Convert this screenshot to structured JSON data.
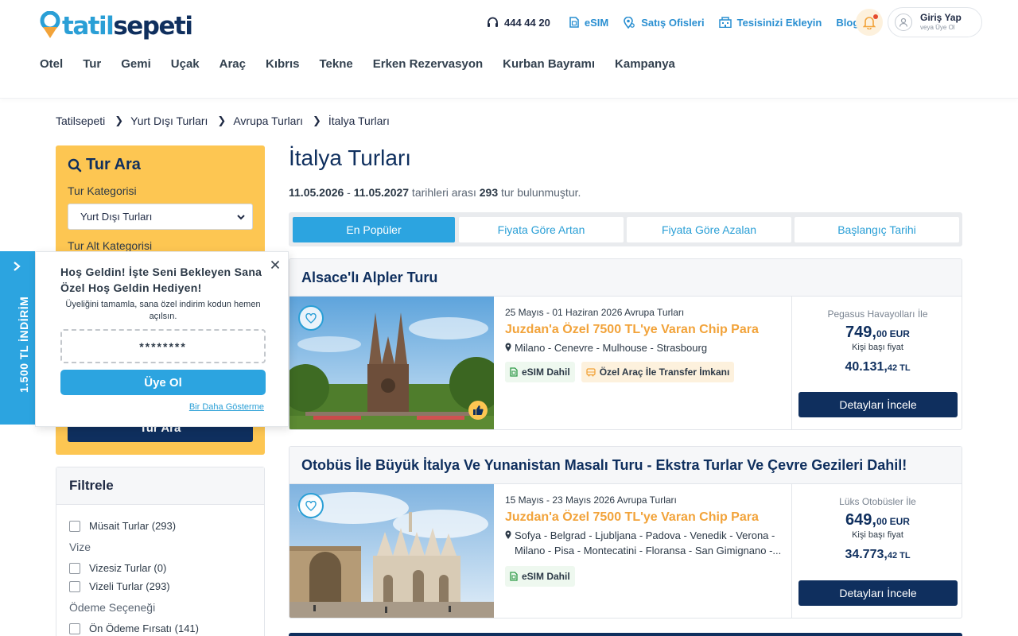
{
  "brand": {
    "part1": "tatil",
    "part2": "sepeti"
  },
  "colors": {
    "primary": "#2ca4e0",
    "navy": "#0f2f5e",
    "accent": "#fdc652",
    "promo": "#f2a33a"
  },
  "header": {
    "phone": "444 44 20",
    "links": [
      "eSIM",
      "Satış Ofisleri",
      "Tesisinizi Ekleyin",
      "Blog"
    ],
    "login_title": "Giriş Yap",
    "login_sub": "veya Üye Ol"
  },
  "nav": [
    "Otel",
    "Tur",
    "Gemi",
    "Uçak",
    "Araç",
    "Kıbrıs",
    "Tekne",
    "Erken Rezervasyon",
    "Kurban Bayramı",
    "Kampanya"
  ],
  "breadcrumb": [
    "Tatilsepeti",
    "Yurt Dışı Turları",
    "Avrupa Turları",
    "İtalya Turları"
  ],
  "search": {
    "title": "Tur Ara",
    "category_label": "Tur Kategorisi",
    "category_value": "Yurt Dışı Turları",
    "sub_label": "Tur Alt Kategorisi",
    "button": "Tur Ara"
  },
  "filters": {
    "title": "Filtrele",
    "musait": "Müsait Turlar (293)",
    "vize_label": "Vize",
    "vizesiz": "Vizesiz Turlar (0)",
    "vizeli": "Vizeli Turlar (293)",
    "odeme_label": "Ödeme Seçeneği",
    "on_odeme": "Ön Ödeme Fırsatı (141)"
  },
  "page": {
    "title": "İtalya Turları",
    "date_from": "11.05.2026",
    "dash": " - ",
    "date_to": "11.05.2027",
    "mid_text": " tarihleri arası ",
    "count": "293",
    "end_text": " tur bulunmuştur."
  },
  "sort_tabs": [
    "En Popüler",
    "Fiyata Göre Artan",
    "Fiyata Göre Azalan",
    "Başlangıç Tarihi"
  ],
  "tours": [
    {
      "title": "Alsace'lı Alpler Turu",
      "date": "25 Mayıs - 01 Haziran 2026 Avrupa Turları",
      "promo": "Juzdan'a Özel 7500 TL'ye Varan Chip Para",
      "route_line1": "Milano - Cenevre - Mulhouse - Strasbourg",
      "route_line2": "",
      "badge1": "eSIM Dahil",
      "badge2": "Özel Araç İle Transfer İmkanı",
      "carrier": "Pegasus Havayolları İle",
      "price_eur_int": "749,",
      "price_eur_dec": "00 EUR",
      "price_label": "Kişi başı fiyat",
      "price_tl_int": "40.131,",
      "price_tl_dec": "42 TL",
      "button": "Detayları İncele"
    },
    {
      "title": "Otobüs İle Büyük İtalya Ve Yunanistan Masalı Turu - Ekstra Turlar Ve Çevre Gezileri Dahil!",
      "date": "15 Mayıs - 23 Mayıs 2026 Avrupa Turları",
      "promo": "Juzdan'a Özel 7500 TL'ye Varan Chip Para",
      "route_line1": "Sofya - Belgrad - Ljubljana - Padova - Venedik - Verona -",
      "route_line2": "Milano - Pisa - Montecatini - Floransa - San Gimignano -...",
      "badge1": "eSIM Dahil",
      "carrier": "Lüks Otobüsler İle",
      "price_eur_int": "649,",
      "price_eur_dec": "00 EUR",
      "price_label": "Kişi başı fiyat",
      "price_tl_int": "34.773,",
      "price_tl_dec": "42 TL",
      "button": "Detayları İncele"
    }
  ],
  "popup": {
    "side_tab": "1.500 TL İNDİRİM",
    "title": "Hoş Geldin! İşte Seni Bekleyen Sana Özel Hoş Geldin Hediyen!",
    "desc": "Üyeliğini tamamla, sana özel indirim kodun hemen açılsın.",
    "code": "********",
    "button": "Üye Ol",
    "dismiss": "Bir Daha Gösterme"
  }
}
